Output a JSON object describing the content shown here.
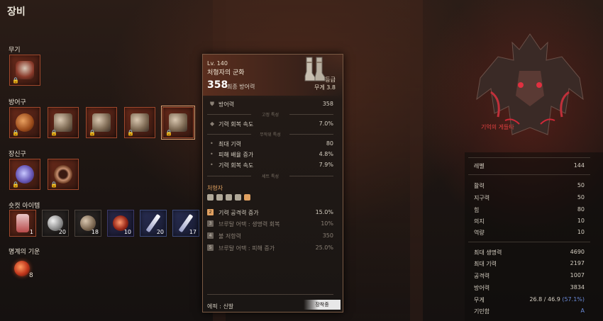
{
  "page": {
    "title": "장비"
  },
  "sections": {
    "weapon": "무기",
    "armor": "방어구",
    "accessory": "장신구",
    "shortcut": "숏컷 아이템",
    "soul": "명계의 기운"
  },
  "quick_items": [
    {
      "count": "1"
    },
    {
      "count": "20"
    },
    {
      "count": "18"
    },
    {
      "count": "10"
    },
    {
      "count": "20"
    },
    {
      "count": "17"
    }
  ],
  "soul_count": "8",
  "tooltip": {
    "level": "Lv. 140",
    "name": "처형자의 군화",
    "defense_value": "358",
    "defense_label": "최종 방어력",
    "grade": "등급",
    "weight": "무게 3.8",
    "base_stat": {
      "label": "방어력",
      "value": "358"
    },
    "fixed_header": "고정 특성",
    "fixed": [
      {
        "label": "기력 회복 속도",
        "value": "7.0%"
      }
    ],
    "random_header": "무작위 특성",
    "random": [
      {
        "label": "최대 기력",
        "value": "80"
      },
      {
        "label": "피해 배율 증가",
        "value": "4.8%"
      },
      {
        "label": "기력 회복 속도",
        "value": "7.9%"
      }
    ],
    "set_header": "세트 특성",
    "set_name": "처형자",
    "set_bonuses": [
      {
        "num": "2",
        "label": "기력 공격력 증가",
        "value": "15.0%",
        "active": true
      },
      {
        "num": "3",
        "label": "브루탈 어택 : 생명력 회복",
        "value": "10%",
        "active": false
      },
      {
        "num": "4",
        "label": "불 저항력",
        "value": "350",
        "active": false
      },
      {
        "num": "5",
        "label": "브루탈 어택 : 피해 증가",
        "value": "25.0%",
        "active": false
      }
    ],
    "rarity": "에픽 : 신발",
    "equipped": "장착중"
  },
  "boss": {
    "name": "기억의 게들타"
  },
  "stats": {
    "level": {
      "label": "레벨",
      "value": "144"
    },
    "attrs": [
      {
        "label": "활력",
        "value": "50"
      },
      {
        "label": "지구력",
        "value": "50"
      },
      {
        "label": "힘",
        "value": "80"
      },
      {
        "label": "의지",
        "value": "10"
      },
      {
        "label": "역량",
        "value": "10"
      }
    ],
    "derived": [
      {
        "label": "최대 생명력",
        "value": "4690"
      },
      {
        "label": "최대 기력",
        "value": "2197"
      },
      {
        "label": "공격력",
        "value": "1007"
      },
      {
        "label": "방어력",
        "value": "3834"
      }
    ],
    "weight": {
      "label": "무게",
      "value": "26.8 / 46.9",
      "pct": "(57.1%)"
    },
    "gimmick": {
      "label": "기민함",
      "value": "A"
    }
  },
  "colors": {
    "accent_orange": "#e0a060",
    "boss_red": "#e04040",
    "stat_blue": "#6a8ad8"
  }
}
